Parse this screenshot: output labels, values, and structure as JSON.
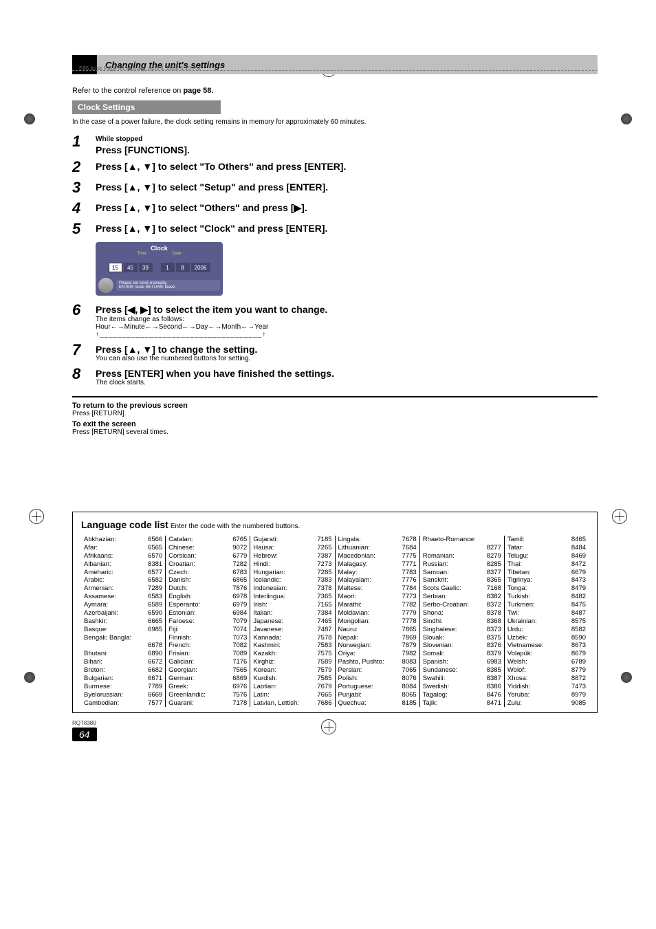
{
  "book_note": "E85.book  Page 64  Monday, April 3, 2006  5:10 PM",
  "section_heading": "Changing the unit's settings",
  "intro": {
    "pre": "Refer to the control reference on ",
    "page_ref": "page 58."
  },
  "subsection": "Clock Settings",
  "power_note": "In the case of a power failure, the clock setting remains in memory for approximately 60 minutes.",
  "steps": {
    "s1": {
      "num": "1",
      "sub": "While stopped",
      "main": "Press [FUNCTIONS]."
    },
    "s2": {
      "num": "2",
      "main": "Press [▲, ▼] to select \"To Others\" and press [ENTER]."
    },
    "s3": {
      "num": "3",
      "main": "Press [▲, ▼] to select \"Setup\" and press [ENTER]."
    },
    "s4": {
      "num": "4",
      "main": "Press [▲, ▼] to select \"Others\" and press [▶]."
    },
    "s5": {
      "num": "5",
      "main": "Press [▲, ▼] to select \"Clock\" and press [ENTER]."
    },
    "s6": {
      "num": "6",
      "main": "Press [◀, ▶] to select the item you want to change.",
      "tiny1": "The items change as follows:",
      "tiny2": "Hour←→Minute←→Second←→Day←→Month←→Year",
      "tiny3": "↑____________________________________↑"
    },
    "s7": {
      "num": "7",
      "main": "Press [▲, ▼] to change the setting.",
      "tiny1": "You can also use the numbered buttons for setting."
    },
    "s8": {
      "num": "8",
      "main": "Press [ENTER] when you have finished the settings.",
      "tiny1": "The clock starts."
    }
  },
  "clock_panel": {
    "title": "Clock",
    "time_label": "Time",
    "date_label": "Date",
    "hour": "15",
    "minute": "45",
    "second": "39",
    "day": "1",
    "month": "8",
    "year": "2006",
    "instr1": "Please set clock manually.",
    "instr2": "ENTER: store   RETURN: leave"
  },
  "return_block": {
    "t1": "To return to the previous screen",
    "b1": "Press [RETURN].",
    "t2": "To exit the screen",
    "b2": "Press [RETURN] several times."
  },
  "lang": {
    "title": "Language code list",
    "subtitle": " Enter the code with the numbered buttons.",
    "cols": [
      [
        [
          "Abkhazian:",
          "6566"
        ],
        [
          "Afar:",
          "6565"
        ],
        [
          "Afrikaans:",
          "6570"
        ],
        [
          "Albanian:",
          "8381"
        ],
        [
          "Ameharic:",
          "6577"
        ],
        [
          "Arabic:",
          "6582"
        ],
        [
          "Armenian:",
          "7289"
        ],
        [
          "Assamese:",
          "6583"
        ],
        [
          "Aymara:",
          "6589"
        ],
        [
          "Azerbaijani:",
          "6590"
        ],
        [
          "Bashkir:",
          "6665"
        ],
        [
          "Basque:",
          "6985"
        ],
        [
          "Bengali; Bangla:",
          ""
        ],
        [
          "",
          "6678"
        ],
        [
          "Bhutani:",
          "6890"
        ],
        [
          "Bihari:",
          "6672"
        ],
        [
          "Breton:",
          "6682"
        ],
        [
          "Bulgarian:",
          "6671"
        ],
        [
          "Burmese:",
          "7789"
        ],
        [
          "Byelorussian:",
          "6669"
        ],
        [
          "Cambodian:",
          "7577"
        ]
      ],
      [
        [
          "Catalan:",
          "6765"
        ],
        [
          "Chinese:",
          "9072"
        ],
        [
          "Corsican:",
          "6779"
        ],
        [
          "Croatian:",
          "7282"
        ],
        [
          "Czech:",
          "6783"
        ],
        [
          "Danish:",
          "6865"
        ],
        [
          "Dutch:",
          "7876"
        ],
        [
          "English:",
          "6978"
        ],
        [
          "Esperanto:",
          "6979"
        ],
        [
          "Estonian:",
          "6984"
        ],
        [
          "Faroese:",
          "7079"
        ],
        [
          "Fiji:",
          "7074"
        ],
        [
          "Finnish:",
          "7073"
        ],
        [
          "French:",
          "7082"
        ],
        [
          "Frisian:",
          "7089"
        ],
        [
          "Galician:",
          "7176"
        ],
        [
          "Georgian:",
          "7565"
        ],
        [
          "German:",
          "6869"
        ],
        [
          "Greek:",
          "6976"
        ],
        [
          "Greenlandic:",
          "7576"
        ],
        [
          "Guarani:",
          "7178"
        ]
      ],
      [
        [
          "Gujarati:",
          "7185"
        ],
        [
          "Hausa:",
          "7265"
        ],
        [
          "Hebrew:",
          "7387"
        ],
        [
          "Hindi:",
          "7273"
        ],
        [
          "Hungarian:",
          "7285"
        ],
        [
          "Icelandic:",
          "7383"
        ],
        [
          "Indonesian:",
          "7378"
        ],
        [
          "Interlingua:",
          "7365"
        ],
        [
          "Irish:",
          "7165"
        ],
        [
          "Italian:",
          "7384"
        ],
        [
          "Japanese:",
          "7465"
        ],
        [
          "Javanese:",
          "7487"
        ],
        [
          "Kannada:",
          "7578"
        ],
        [
          "Kashmiri:",
          "7583"
        ],
        [
          "Kazakh:",
          "7575"
        ],
        [
          "Kirghiz:",
          "7589"
        ],
        [
          "Korean:",
          "7579"
        ],
        [
          "Kurdish:",
          "7585"
        ],
        [
          "Laotian:",
          "7679"
        ],
        [
          "Latin:",
          "7665"
        ],
        [
          "Latvian, Lettish:",
          "7686"
        ]
      ],
      [
        [
          "Lingala:",
          "7678"
        ],
        [
          "Lithuanian:",
          "7684"
        ],
        [
          "Macedonian:",
          "7775"
        ],
        [
          "Malagasy:",
          "7771"
        ],
        [
          "Malay:",
          "7783"
        ],
        [
          "Malayalam:",
          "7776"
        ],
        [
          "Maltese:",
          "7784"
        ],
        [
          "Maori:",
          "7773"
        ],
        [
          "Marathi:",
          "7782"
        ],
        [
          "Moldavian:",
          "7779"
        ],
        [
          "Mongolian:",
          "7778"
        ],
        [
          "Nauru:",
          "7865"
        ],
        [
          "Nepali:",
          "7869"
        ],
        [
          "Norwegian:",
          "7879"
        ],
        [
          "Oriya:",
          "7982"
        ],
        [
          "Pashto, Pushto:",
          "8083"
        ],
        [
          "Persian:",
          "7065"
        ],
        [
          "Polish:",
          "8076"
        ],
        [
          "Portuguese:",
          "8084"
        ],
        [
          "Punjabi:",
          "8065"
        ],
        [
          "Quechua:",
          "8185"
        ]
      ],
      [
        [
          "Rhaeto-Romance:",
          ""
        ],
        [
          "",
          "8277"
        ],
        [
          "Romanian:",
          "8279"
        ],
        [
          "Russian:",
          "8285"
        ],
        [
          "Samoan:",
          "8377"
        ],
        [
          "Sanskrit:",
          "8365"
        ],
        [
          "Scots Gaelic:",
          "7168"
        ],
        [
          "Serbian:",
          "8382"
        ],
        [
          "Serbo-Croatian:",
          "8372"
        ],
        [
          "Shona:",
          "8378"
        ],
        [
          "Sindhi:",
          "8368"
        ],
        [
          "Singhalese:",
          "8373"
        ],
        [
          "Slovak:",
          "8375"
        ],
        [
          "Slovenian:",
          "8376"
        ],
        [
          "Somali:",
          "8379"
        ],
        [
          "Spanish:",
          "6983"
        ],
        [
          "Sundanese:",
          "8385"
        ],
        [
          "Swahili:",
          "8387"
        ],
        [
          "Swedish:",
          "8386"
        ],
        [
          "Tagalog:",
          "8476"
        ],
        [
          "Tajik:",
          "8471"
        ]
      ],
      [
        [
          "Tamil:",
          "8465"
        ],
        [
          "Tatar:",
          "8484"
        ],
        [
          "Telugu:",
          "8469"
        ],
        [
          "Thai:",
          "8472"
        ],
        [
          "Tibetan:",
          "6679"
        ],
        [
          "Tigrinya:",
          "8473"
        ],
        [
          "Tonga:",
          "8479"
        ],
        [
          "Turkish:",
          "8482"
        ],
        [
          "Turkmen:",
          "8475"
        ],
        [
          "Twi:",
          "8487"
        ],
        [
          "Ukrainian:",
          "8575"
        ],
        [
          "Urdu:",
          "8582"
        ],
        [
          "Uzbek:",
          "8590"
        ],
        [
          "Vietnamese:",
          "8673"
        ],
        [
          "Volapük:",
          "8679"
        ],
        [
          "Welsh:",
          "6789"
        ],
        [
          "Wolof:",
          "8779"
        ],
        [
          "Xhosa:",
          "8872"
        ],
        [
          "Yiddish:",
          "7473"
        ],
        [
          "Yoruba:",
          "8979"
        ],
        [
          "Zulu:",
          "9085"
        ]
      ]
    ]
  },
  "footer": {
    "rcode": "RQT8380",
    "pnum": "64"
  }
}
